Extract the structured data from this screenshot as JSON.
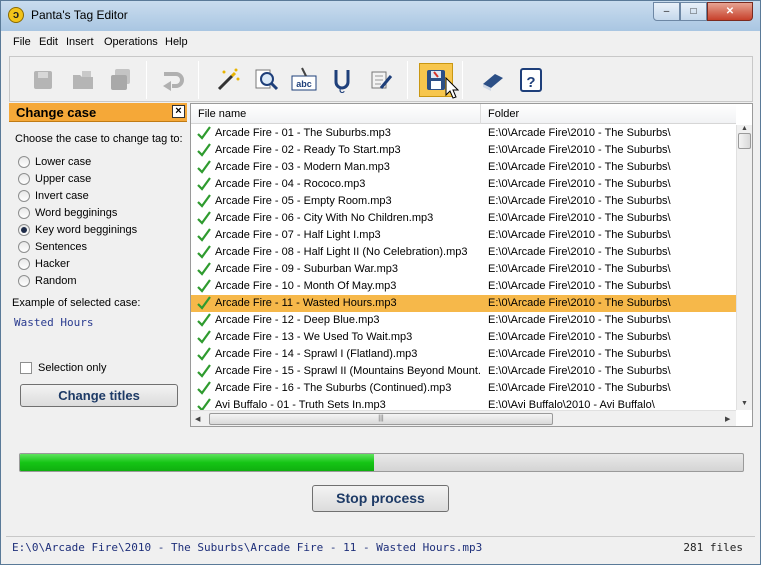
{
  "window": {
    "title": "Panta's Tag Editor",
    "minimize": "–",
    "maximize": "□",
    "close": "✕"
  },
  "menu": [
    "File",
    "Edit",
    "Insert",
    "Operations",
    "Help"
  ],
  "toolbar": {
    "buttons": [
      {
        "icon": "save-disk-icon",
        "enabled": false
      },
      {
        "icon": "folder-open-icon",
        "enabled": false
      },
      {
        "icon": "save-all-icon",
        "enabled": false
      },
      {
        "icon": "undo-arrow-icon",
        "enabled": false
      },
      {
        "icon": "magic-wand-icon",
        "enabled": true
      },
      {
        "icon": "magnifier-find-icon",
        "enabled": true
      },
      {
        "icon": "abc-rename-icon",
        "enabled": true
      },
      {
        "icon": "change-case-icon",
        "enabled": true
      },
      {
        "icon": "scroll-edit-icon",
        "enabled": true
      },
      {
        "icon": "floppy-process-icon",
        "enabled": true,
        "active": true
      },
      {
        "icon": "help-book-icon",
        "enabled": true
      },
      {
        "icon": "question-icon",
        "enabled": true
      }
    ]
  },
  "panel": {
    "title": "Change case",
    "close": "×",
    "choose_label": "Choose the case to change tag to:",
    "options": [
      "Lower case",
      "Upper case",
      "Invert case",
      "Word begginings",
      "Key word begginings",
      "Sentences",
      "Hacker",
      "Random"
    ],
    "selected_option": 4,
    "example_label": "Example of selected case:",
    "example_value": "Wasted Hours",
    "selection_only_label": "Selection only",
    "selection_only_checked": false,
    "change_titles_label": "Change titles"
  },
  "listview": {
    "columns": [
      "File name",
      "Folder"
    ],
    "selected_index": 10,
    "rows": [
      {
        "file": "Arcade Fire - 01 - The Suburbs.mp3",
        "folder": "E:\\0\\Arcade Fire\\2010 - The Suburbs\\"
      },
      {
        "file": "Arcade Fire - 02 - Ready To Start.mp3",
        "folder": "E:\\0\\Arcade Fire\\2010 - The Suburbs\\"
      },
      {
        "file": "Arcade Fire - 03 - Modern Man.mp3",
        "folder": "E:\\0\\Arcade Fire\\2010 - The Suburbs\\"
      },
      {
        "file": "Arcade Fire - 04 - Rococo.mp3",
        "folder": "E:\\0\\Arcade Fire\\2010 - The Suburbs\\"
      },
      {
        "file": "Arcade Fire - 05 - Empty Room.mp3",
        "folder": "E:\\0\\Arcade Fire\\2010 - The Suburbs\\"
      },
      {
        "file": "Arcade Fire - 06 - City With No Children.mp3",
        "folder": "E:\\0\\Arcade Fire\\2010 - The Suburbs\\"
      },
      {
        "file": "Arcade Fire - 07 - Half Light I.mp3",
        "folder": "E:\\0\\Arcade Fire\\2010 - The Suburbs\\"
      },
      {
        "file": "Arcade Fire - 08 - Half Light II (No Celebration).mp3",
        "folder": "E:\\0\\Arcade Fire\\2010 - The Suburbs\\"
      },
      {
        "file": "Arcade Fire - 09 - Suburban War.mp3",
        "folder": "E:\\0\\Arcade Fire\\2010 - The Suburbs\\"
      },
      {
        "file": "Arcade Fire - 10 - Month Of May.mp3",
        "folder": "E:\\0\\Arcade Fire\\2010 - The Suburbs\\"
      },
      {
        "file": "Arcade Fire - 11 - Wasted Hours.mp3",
        "folder": "E:\\0\\Arcade Fire\\2010 - The Suburbs\\"
      },
      {
        "file": "Arcade Fire - 12 - Deep Blue.mp3",
        "folder": "E:\\0\\Arcade Fire\\2010 - The Suburbs\\"
      },
      {
        "file": "Arcade Fire - 13 - We Used To Wait.mp3",
        "folder": "E:\\0\\Arcade Fire\\2010 - The Suburbs\\"
      },
      {
        "file": "Arcade Fire - 14 - Sprawl I (Flatland).mp3",
        "folder": "E:\\0\\Arcade Fire\\2010 - The Suburbs\\"
      },
      {
        "file": "Arcade Fire - 15 - Sprawl II (Mountains Beyond Mount...",
        "folder": "E:\\0\\Arcade Fire\\2010 - The Suburbs\\"
      },
      {
        "file": "Arcade Fire - 16 - The Suburbs (Continued).mp3",
        "folder": "E:\\0\\Arcade Fire\\2010 - The Suburbs\\"
      },
      {
        "file": "Avi Buffalo - 01 - Truth Sets In.mp3",
        "folder": "E:\\0\\Avi Buffalo\\2010 - Avi Buffalo\\"
      }
    ]
  },
  "progress": {
    "fraction": 0.49
  },
  "stop_label": "Stop process",
  "status": {
    "path": "E:\\0\\Arcade Fire\\2010 - The Suburbs\\Arcade Fire - 11 - Wasted Hours.mp3",
    "count": "281 files"
  },
  "colors": {
    "selection": "#f6b84a",
    "panel_header": "#f5a838",
    "progress": "#15c515",
    "check": "#2f9b2f",
    "accent_text": "#1d3a66"
  }
}
